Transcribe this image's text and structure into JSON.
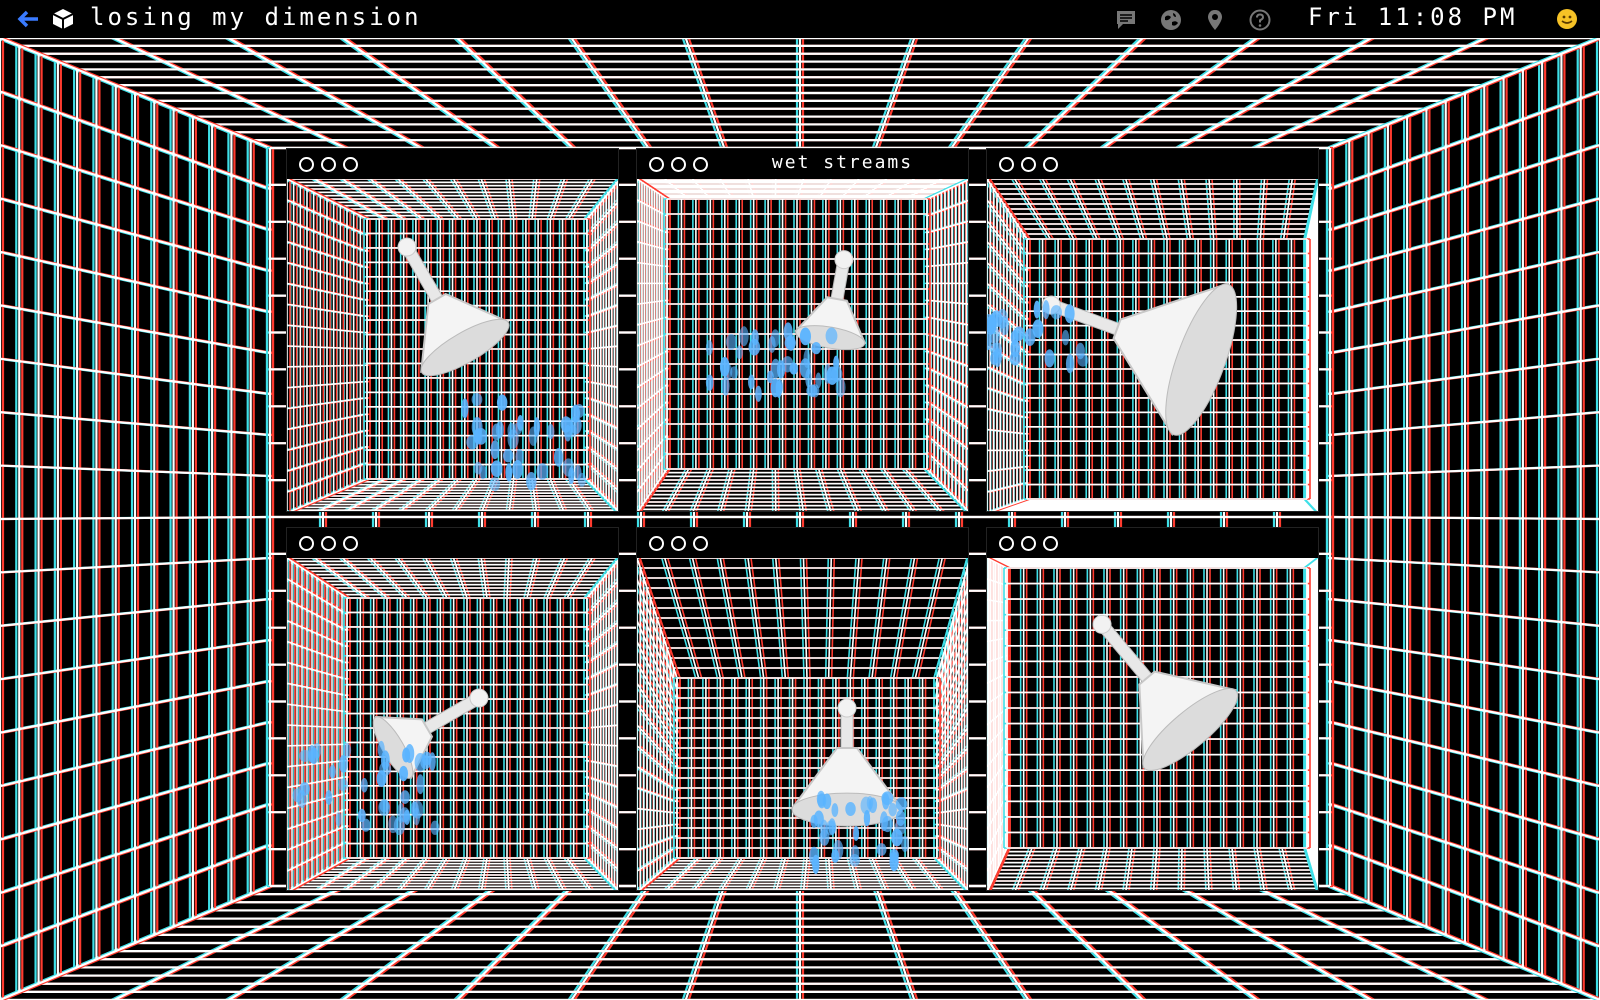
{
  "menubar": {
    "title": "losing my dimension",
    "clock": "Fri 11:08 PM",
    "back_icon": "back-arrow-icon",
    "app_icon": "cube-icon",
    "tray_icons": [
      "chat-icon",
      "globe-icon",
      "location-pin-icon",
      "help-icon"
    ],
    "user_icon": "smiley-icon"
  },
  "colors": {
    "background": "#000000",
    "grid_white": "#ffffff",
    "grid_red": "#ff3b2f",
    "grid_cyan": "#3fe0e8",
    "water": "#5ab4ff",
    "accent_back": "#3a7bff"
  },
  "windows": [
    {
      "title": "",
      "scene": "shower-head-angled-right"
    },
    {
      "title": "wet streams",
      "scene": "shower-head-spraying-left"
    },
    {
      "title": "",
      "scene": "shower-head-close-up"
    },
    {
      "title": "",
      "scene": "shower-head-spraying-left-low"
    },
    {
      "title": "",
      "scene": "shower-head-facing-down"
    },
    {
      "title": "",
      "scene": "shower-head-dry"
    }
  ]
}
